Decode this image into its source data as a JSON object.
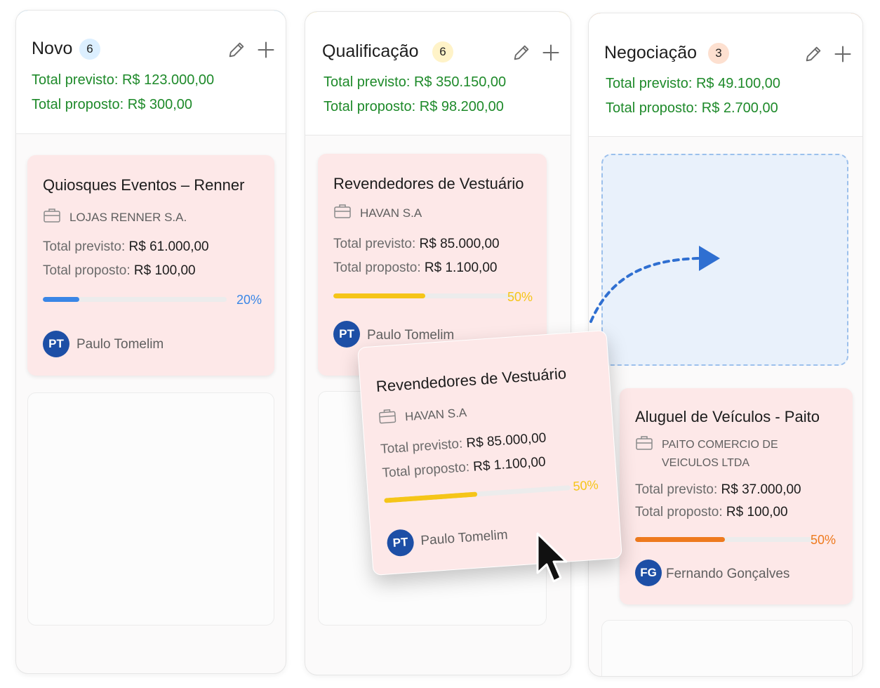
{
  "colors": {
    "blue_accent": "#29a3e6",
    "yellow_accent": "#f5c518",
    "orange_accent": "#ee7a1e",
    "green_totals": "#1e8a2a",
    "progress_blue": "#3a86e6",
    "progress_yellow": "#f5c518",
    "progress_orange": "#ee7a1e",
    "card_background": "#fde8e8",
    "avatar": "#1d4fa6"
  },
  "icons": {
    "edit": "pencil-icon",
    "add": "plus-icon",
    "company": "briefcase-icon",
    "drag_arrow": "dashed-curved-arrow-icon",
    "cursor": "mouse-pointer-icon"
  },
  "columns": [
    {
      "title": "Novo",
      "count": "6",
      "total_previsto": "Total previsto: R$ 123.000,00",
      "total_proposto": "Total proposto: R$ 300,00",
      "cards": [
        {
          "title": "Quiosques Eventos – Renner",
          "company": "LOJAS RENNER S.A.",
          "previsto_label": "Total previsto:",
          "previsto_value": "R$ 61.000,00",
          "proposto_label": "Total proposto:",
          "proposto_value": "R$ 100,00",
          "progress": 0.2,
          "progress_label": "20%",
          "owner_initials": "PT",
          "owner": "Paulo Tomelim"
        }
      ]
    },
    {
      "title": "Qualificação",
      "count": "6",
      "total_previsto": "Total previsto: R$ 350.150,00",
      "total_proposto": "Total proposto: R$ 98.200,00",
      "cards": [
        {
          "title": "Revendedores de Vestuário",
          "company": "HAVAN S.A",
          "previsto_label": "Total previsto:",
          "previsto_value": "R$ 85.000,00",
          "proposto_label": "Total proposto:",
          "proposto_value": "R$ 1.100,00",
          "progress": 0.5,
          "progress_label": "50%",
          "owner_initials": "PT",
          "owner": "Paulo Tomelim"
        }
      ]
    },
    {
      "title": "Negociação",
      "count": "3",
      "total_previsto": "Total previsto: R$ 49.100,00",
      "total_proposto": "Total proposto: R$ 2.700,00",
      "cards": [
        {
          "title": "Aluguel de Veículos - Paito",
          "company_line1": "PAITO COMERCIO DE",
          "company_line2": "VEICULOS LTDA",
          "previsto_label": "Total previsto:",
          "previsto_value": "R$ 37.000,00",
          "proposto_label": "Total proposto:",
          "proposto_value": "R$ 100,00",
          "progress": 0.5,
          "progress_label": "50%",
          "owner_initials": "FG",
          "owner": "Fernando Gonçalves"
        }
      ]
    }
  ],
  "dragging_card": {
    "title": "Revendedores de Vestuário",
    "company": "HAVAN S.A",
    "previsto_label": "Total previsto:",
    "previsto_value": "R$ 85.000,00",
    "proposto_label": "Total proposto:",
    "proposto_value": "R$ 1.100,00",
    "progress": 0.5,
    "progress_label": "50%",
    "owner_initials": "PT",
    "owner": "Paulo Tomelim"
  }
}
